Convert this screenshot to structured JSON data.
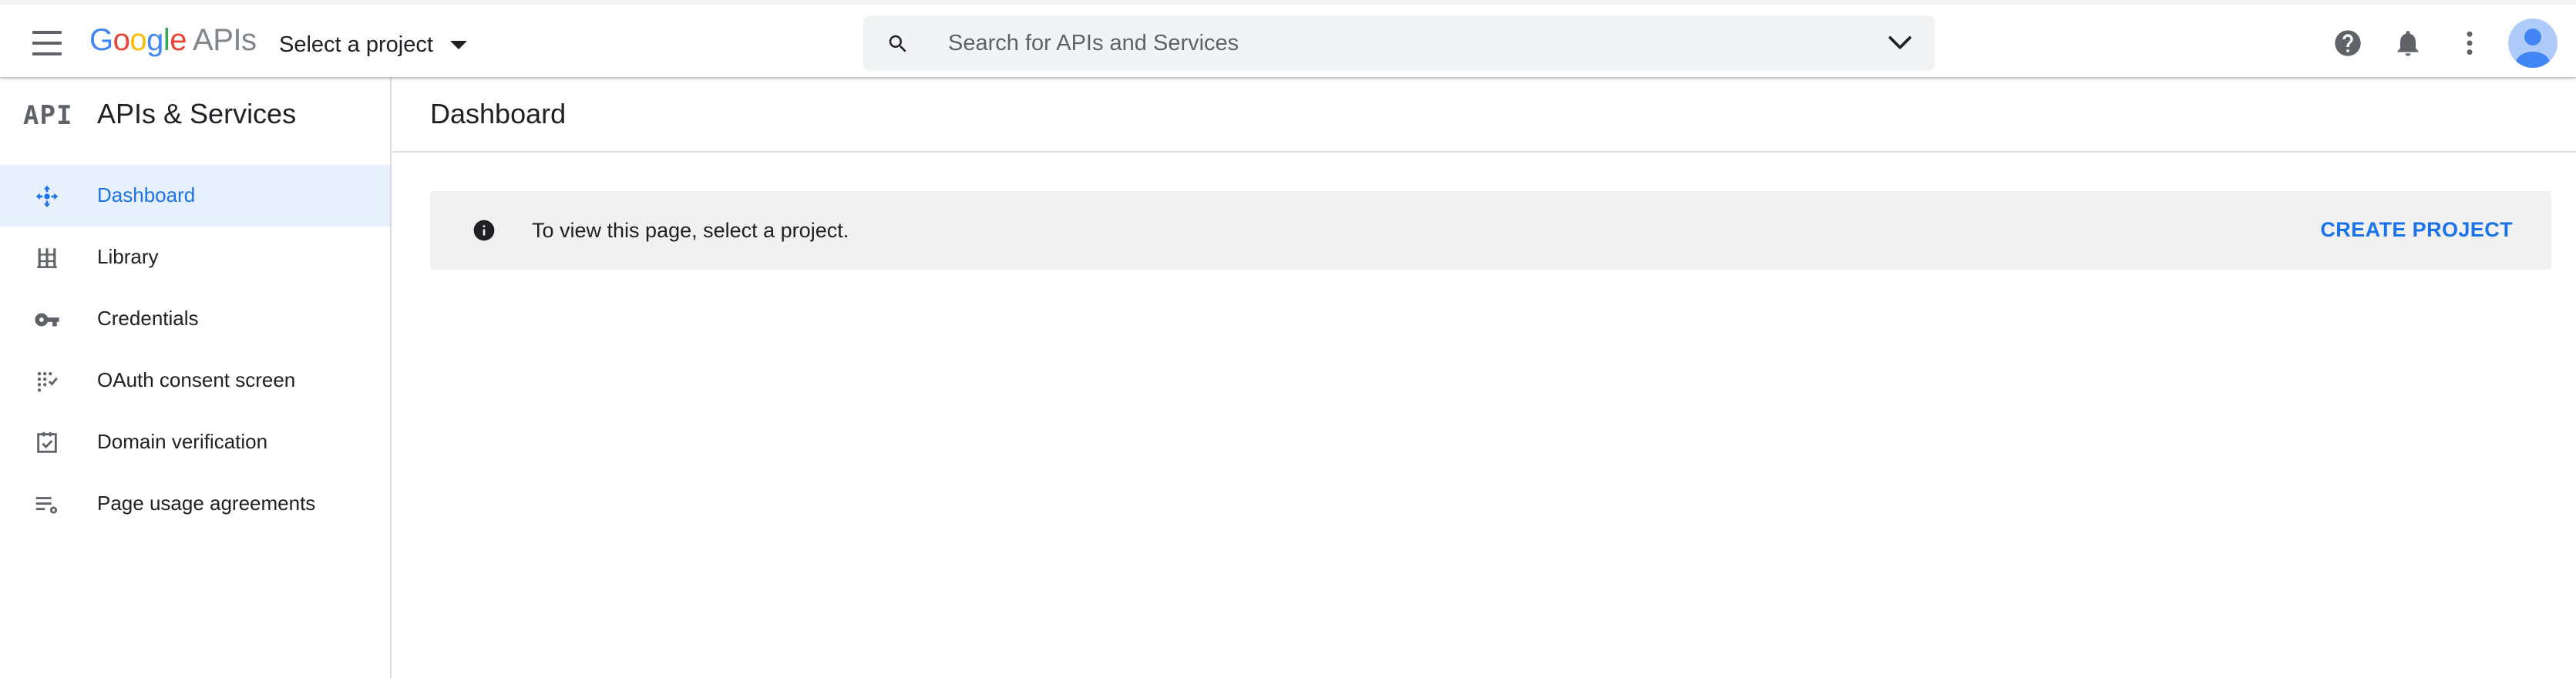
{
  "header": {
    "logo": {
      "letters": [
        "G",
        "o",
        "o",
        "g",
        "l",
        "e"
      ],
      "product": "APIs"
    },
    "project_select": {
      "label": "Select a project"
    },
    "search": {
      "placeholder": "Search for APIs and Services",
      "value": ""
    },
    "icons": [
      "menu-icon",
      "search-icon",
      "chevron-down-icon",
      "help-icon",
      "notifications-bell-icon",
      "more-vert-icon",
      "account-avatar"
    ]
  },
  "sidebar": {
    "badge": "API",
    "title": "APIs & Services",
    "items": [
      {
        "label": "Dashboard",
        "icon": "dashboard-icon",
        "active": true
      },
      {
        "label": "Library",
        "icon": "library-icon",
        "active": false
      },
      {
        "label": "Credentials",
        "icon": "key-icon",
        "active": false
      },
      {
        "label": "OAuth consent screen",
        "icon": "consent-icon",
        "active": false
      },
      {
        "label": "Domain verification",
        "icon": "checkbox-icon",
        "active": false
      },
      {
        "label": "Page usage agreements",
        "icon": "list-settings-icon",
        "active": false
      }
    ]
  },
  "main": {
    "title": "Dashboard",
    "banner": {
      "message": "To view this page, select a project.",
      "action": "CREATE PROJECT",
      "icon": "info-icon"
    }
  },
  "colors": {
    "accent": "#1a73e8",
    "active_bg": "#e8f0fe",
    "banner_bg": "#f1f1f1",
    "icon_grey": "#5f6368",
    "avatar_bg": "#aecbfa",
    "avatar_fg": "#4285f4"
  }
}
